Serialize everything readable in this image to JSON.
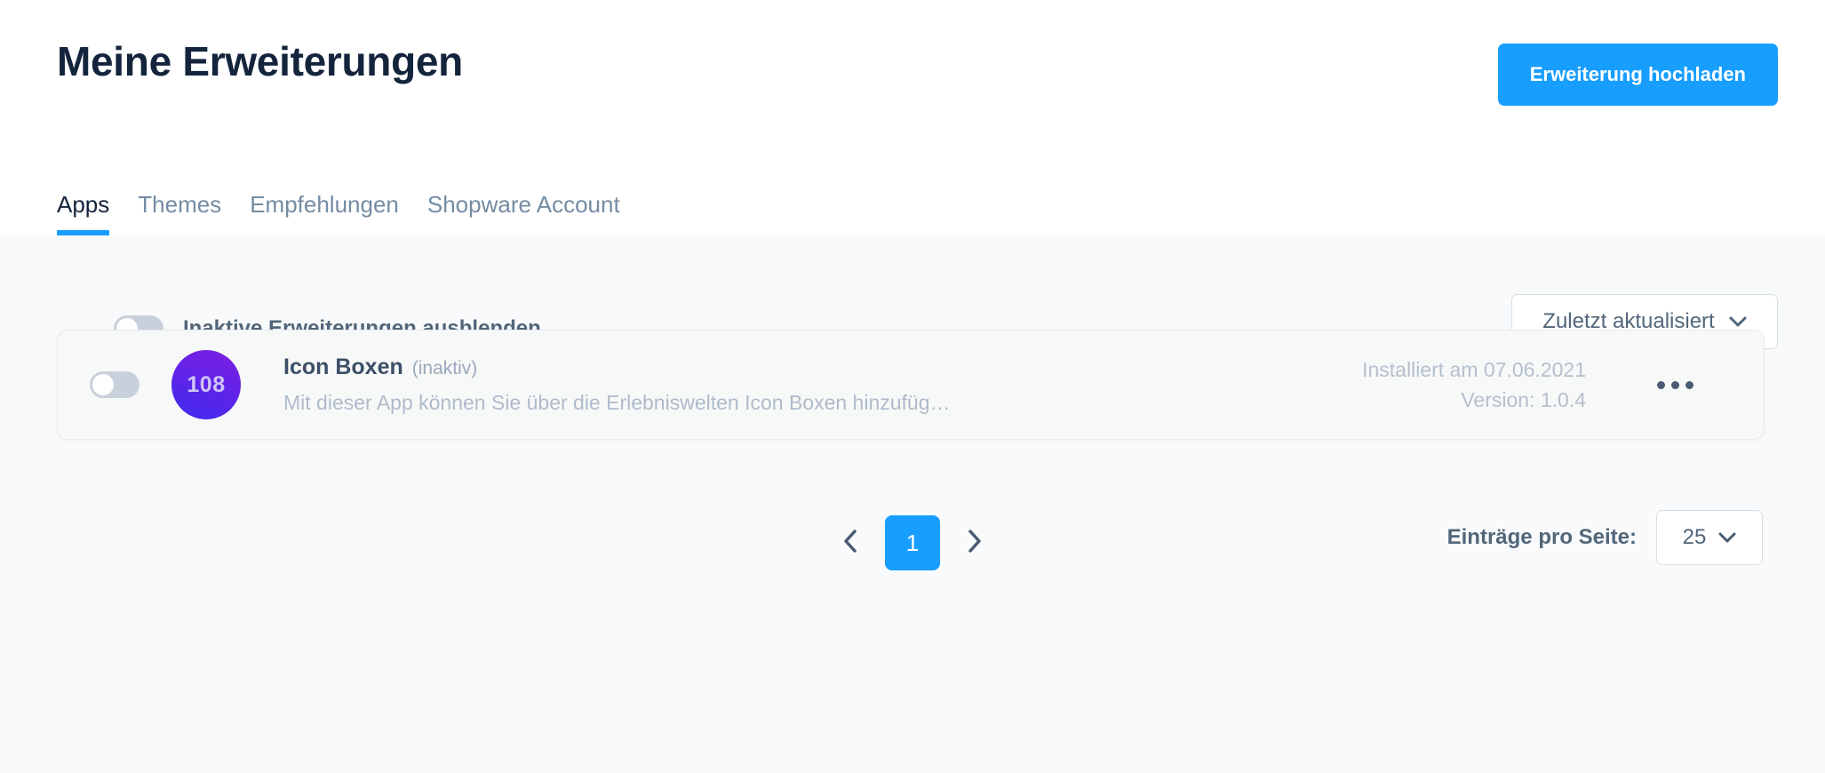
{
  "header": {
    "title": "Meine Erweiterungen",
    "upload_button": "Erweiterung hochladen",
    "accent_color": "#189EFF",
    "title_color": "#14243C"
  },
  "tabs": [
    {
      "label": "Apps",
      "active": true
    },
    {
      "label": "Themes",
      "active": false
    },
    {
      "label": "Empfehlungen",
      "active": false
    },
    {
      "label": "Shopware Account",
      "active": false
    }
  ],
  "filters": {
    "hide_inactive_label": "Inaktive Erweiterungen ausblenden",
    "hide_inactive_value": "off",
    "sort_label": "Zuletzt aktualisiert",
    "sort_icon": "chevron-down-icon"
  },
  "extensions": [
    {
      "toggle_state": "off",
      "icon_text": "108",
      "icon_gradient_from": "#7B1FE0",
      "icon_gradient_to": "#3E2BEF",
      "name": "Icon Boxen",
      "state": "(inaktiv)",
      "description": "Mit dieser App können Sie über die Erlebniswelten Icon Boxen hinzufüg…",
      "installed": "Installiert am 07.06.2021",
      "version": "Version: 1.0.4",
      "actions_icon": "more-horizontal-icon"
    }
  ],
  "pagination": {
    "prev_icon": "chevron-left-icon",
    "next_icon": "chevron-right-icon",
    "current_page": "1",
    "per_page_label": "Einträge pro Seite:",
    "per_page_value": "25",
    "per_page_icon": "chevron-down-icon"
  }
}
